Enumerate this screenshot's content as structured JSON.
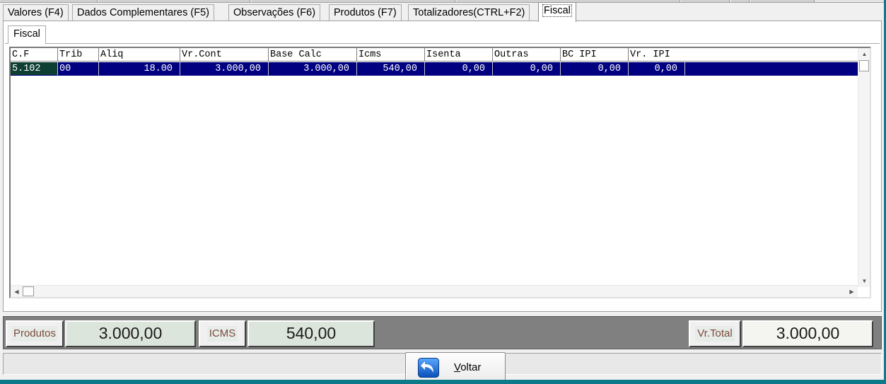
{
  "main_tabs": [
    {
      "label": "Valores (F4)",
      "active": false
    },
    {
      "label": "Dados Complementares (F5)",
      "active": false
    },
    {
      "label": "Observações (F6)",
      "active": false
    },
    {
      "label": "Produtos (F7)",
      "active": false
    },
    {
      "label": "Totalizadores(CTRL+F2)",
      "active": false
    },
    {
      "label": "Fiscal",
      "active": true
    }
  ],
  "inner_tab": {
    "label": "Fiscal"
  },
  "grid": {
    "columns": [
      "C.F",
      "Trib",
      "Aliq",
      "Vr.Cont",
      "Base Calc",
      "Icms",
      "Isenta",
      "Outras",
      "BC IPI",
      "Vr. IPI"
    ],
    "rows": [
      [
        "5.102",
        "00",
        "18.00",
        "3.000,00",
        "3.000,00",
        "540,00",
        "0,00",
        "0,00",
        "0,00",
        "0,00"
      ]
    ],
    "selected_row": 0
  },
  "totals": {
    "produtos_label": "Produtos",
    "produtos_value": "3.000,00",
    "icms_label": "ICMS",
    "icms_value": "540,00",
    "vrtotal_label": "Vr.Total",
    "vrtotal_value": "3.000,00"
  },
  "buttons": {
    "voltar_label_prefix": "V",
    "voltar_label_rest": "oltar"
  },
  "colors": {
    "selection_bg": "#000080",
    "first_cell_bg": "#0f3f32",
    "totals_bar_bg": "#808080",
    "label_text": "#7a4a3a"
  }
}
